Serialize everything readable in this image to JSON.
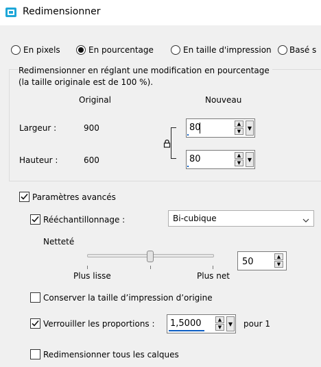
{
  "window": {
    "title": "Redimensionner"
  },
  "mode_options": [
    {
      "label": "En pixels",
      "selected": false
    },
    {
      "label": "En pourcentage",
      "selected": true
    },
    {
      "label": "En taille d'impression",
      "selected": false
    },
    {
      "label": "Basé s",
      "selected": false
    }
  ],
  "percentage_group": {
    "description_line1": "Redimensionner en réglant une modification en pourcentage",
    "description_line2": "(la taille originale est de 100 %).",
    "col_original": "Original",
    "col_new": "Nouveau",
    "width_label": "Largeur :",
    "width_original": "900",
    "width_new": "80",
    "height_label": "Hauteur :",
    "height_original": "600",
    "height_new": "80"
  },
  "advanced": {
    "label": "Paramètres avancés",
    "checked": true,
    "resample_label": "Rééchantillonnage :",
    "resample_checked": true,
    "resample_method": "Bi-cubique",
    "sharpness_label": "Netteté",
    "sharpness_value": "50",
    "sharpness_level": 50,
    "slider_left_label": "Plus lisse",
    "slider_right_label": "Plus net",
    "keep_print_size_label": "Conserver la taille d’impression d’origine",
    "keep_print_size_checked": false,
    "lock_ratio_label": "Verrouiller les proportions :",
    "lock_ratio_checked": true,
    "ratio_value": "1,5000",
    "ratio_suffix": "pour 1",
    "resize_all_layers_label": "Redimensionner tous les calques",
    "resize_all_layers_checked": false
  },
  "icons": {
    "app": "resize-app-icon",
    "lock": "padlock-icon",
    "check": "checkmark-icon",
    "dropdown": "chevron-down-icon"
  },
  "colors": {
    "accent": "#0a5cc2",
    "app_icon": "#1ea7d8"
  }
}
